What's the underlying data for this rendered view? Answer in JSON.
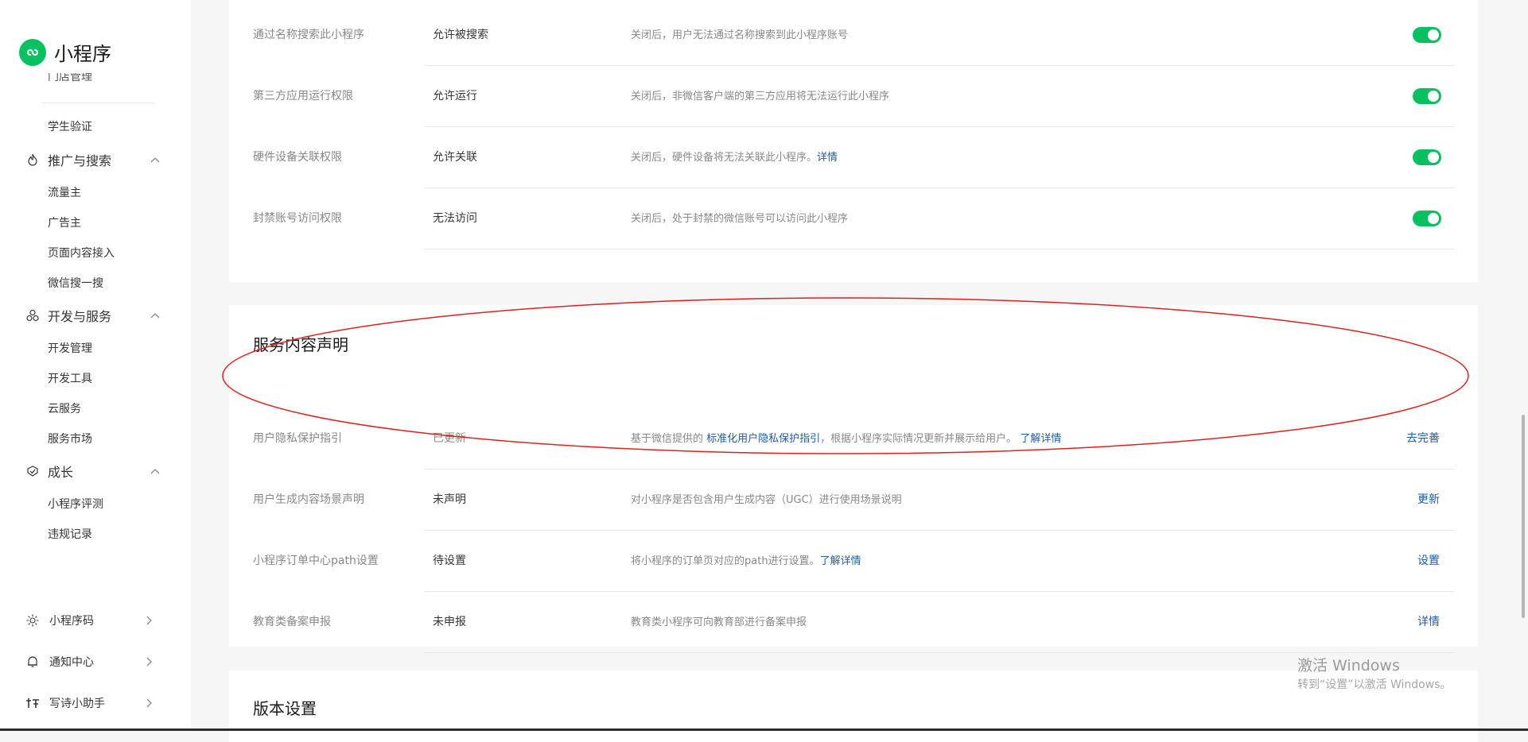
{
  "sidebar": {
    "app_title": "小程序",
    "cut_item": "门店管理",
    "student_verify": "学生验证",
    "groups": [
      {
        "label": "推广与搜索",
        "items": [
          "流量主",
          "广告主",
          "页面内容接入",
          "微信搜一搜"
        ]
      },
      {
        "label": "开发与服务",
        "items": [
          "开发管理",
          "开发工具",
          "云服务",
          "服务市场"
        ]
      },
      {
        "label": "成长",
        "items": [
          "小程序评测",
          "违规记录"
        ]
      }
    ],
    "bottom": [
      {
        "label": "小程序码"
      },
      {
        "label": "通知中心"
      },
      {
        "label": "写诗小助手"
      }
    ]
  },
  "permissions": {
    "rows": [
      {
        "label": "通过名称搜索此小程序",
        "value": "允许被搜索",
        "desc": "关闭后，用户无法通过名称搜索到此小程序账号"
      },
      {
        "label": "第三方应用运行权限",
        "value": "允许运行",
        "desc": "关闭后，非微信客户端的第三方应用将无法运行此小程序"
      },
      {
        "label": "硬件设备关联权限",
        "value": "允许关联",
        "desc": "关闭后，硬件设备将无法关联此小程序。",
        "link": "详情"
      },
      {
        "label": "封禁账号访问权限",
        "value": "无法访问",
        "desc": "关闭后，处于封禁的微信账号可以访问此小程序"
      }
    ]
  },
  "service": {
    "title": "服务内容声明",
    "rows": [
      {
        "label": "用户隐私保护指引",
        "value": "已更新",
        "desc_pre": "基于微信提供的",
        "desc_link": "标准化用户隐私保护指引",
        "desc_post": "，根据小程序实际情况更新并展示给用户。",
        "desc_link2": "了解详情",
        "action": "去完善"
      },
      {
        "label": "用户生成内容场景声明",
        "value": "未声明",
        "desc": "对小程序是否包含用户生成内容（UGC）进行使用场景说明",
        "action": "更新"
      },
      {
        "label": "小程序订单中心path设置",
        "value": "待设置",
        "desc": "将小程序的订单页对应的path进行设置。",
        "desc_link": "了解详情",
        "action": "设置"
      },
      {
        "label": "教育类备案申报",
        "value": "未申报",
        "desc": "教育类小程序可向教育部进行备案申报",
        "action": "详情"
      }
    ]
  },
  "version": {
    "title": "版本设置"
  },
  "watermark": {
    "line1": "激活 Windows",
    "line2": "转到“设置”以激活 Windows。"
  },
  "colors": {
    "accent_green": "#07c160",
    "link_blue": "#1f5ba6",
    "annotation_red": "#e0201c"
  }
}
